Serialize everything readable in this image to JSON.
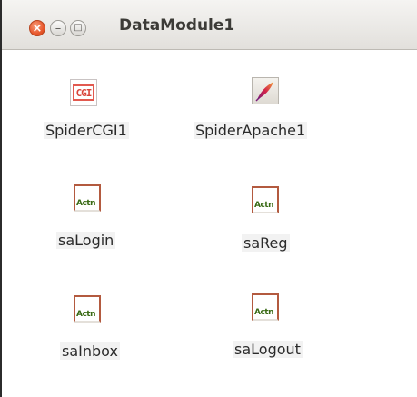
{
  "window": {
    "title": "DataModule1",
    "controls": {
      "close_icon": "×",
      "minimize_icon": "–",
      "maximize_icon": "□"
    }
  },
  "components": [
    {
      "name": "SpiderCGI1",
      "icon": "cgi-icon",
      "icon_text": "CGI"
    },
    {
      "name": "SpiderApache1",
      "icon": "apache-feather-icon"
    },
    {
      "name": "saLogin",
      "icon": "action-icon",
      "icon_text": "Actn"
    },
    {
      "name": "saReg",
      "icon": "action-icon",
      "icon_text": "Actn"
    },
    {
      "name": "saInbox",
      "icon": "action-icon",
      "icon_text": "Actn"
    },
    {
      "name": "saLogout",
      "icon": "action-icon",
      "icon_text": "Actn"
    }
  ]
}
